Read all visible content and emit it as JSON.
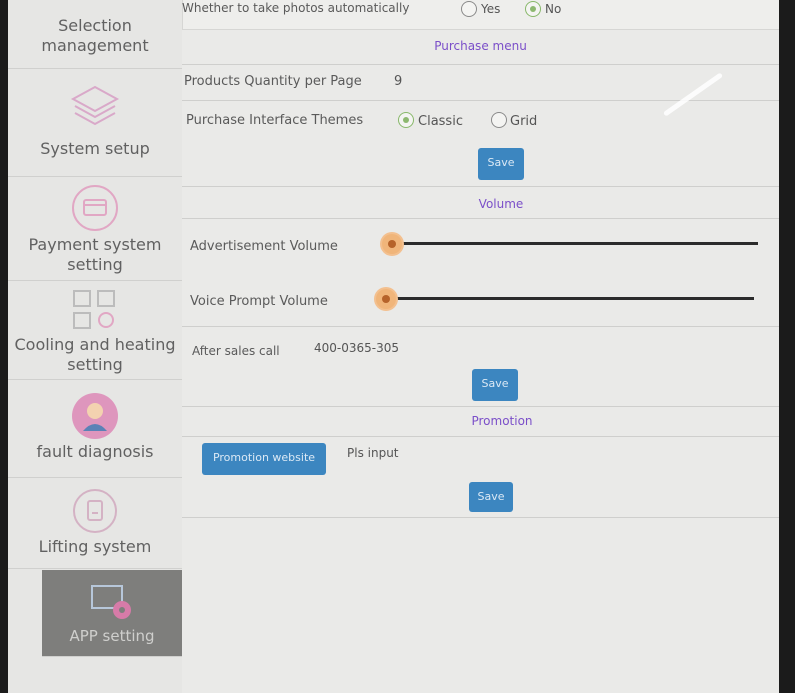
{
  "sidebar": {
    "items": [
      {
        "label": "Selection management",
        "icon": "selection-icon"
      },
      {
        "label": "System setup",
        "icon": "layers-icon"
      },
      {
        "label": "Payment system setting",
        "icon": "payment-card-icon"
      },
      {
        "label": "Cooling and heating setting",
        "icon": "grid-gear-icon"
      },
      {
        "label": "fault diagnosis",
        "icon": "person-icon"
      },
      {
        "label": "Lifting system",
        "icon": "lift-icon"
      },
      {
        "label": "APP setting",
        "icon": "monitor-gear-icon"
      }
    ]
  },
  "photos": {
    "label": "Whether to take photos automatically",
    "options": [
      "Yes",
      "No"
    ],
    "selected": "No"
  },
  "purchase": {
    "title": "Purchase menu",
    "quantity_label": "Products Quantity per Page",
    "quantity_value": "9",
    "theme_label": "Purchase Interface Themes",
    "theme_options": [
      "Classic",
      "Grid"
    ],
    "theme_selected": "Classic",
    "save_label": "Save"
  },
  "volume": {
    "title": "Volume",
    "ad_label": "Advertisement Volume",
    "ad_level": 0,
    "voice_label": "Voice Prompt Volume",
    "voice_level": 0
  },
  "after_sales": {
    "label": "After sales call",
    "value": "400-0365-305",
    "save_label": "Save"
  },
  "promotion": {
    "title": "Promotion",
    "button_label": "Promotion website",
    "input_placeholder": "Pls input",
    "save_label": "Save"
  },
  "colors": {
    "accent": "#3c86c0",
    "section_title": "#7b4fc9",
    "radio_selected": "#8db870",
    "slider_thumb": "#f0b57a"
  }
}
